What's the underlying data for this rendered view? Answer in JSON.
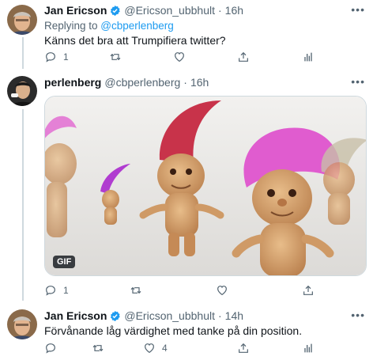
{
  "tweets": [
    {
      "name": "Jan Ericson",
      "handle": "@Ericson_ubbhult",
      "dot": "·",
      "time": "16h",
      "reply_prefix": "Replying to ",
      "reply_handle": "@cbperlenberg",
      "text": "Känns det bra att Trumpifiera twitter?",
      "reply_count": "1",
      "retweet_count": "",
      "like_count": ""
    },
    {
      "name": "perlenberg",
      "handle": "@cbperlenberg",
      "dot": "·",
      "time": "16h",
      "media_badge": "GIF",
      "reply_count": "1",
      "retweet_count": "",
      "like_count": ""
    },
    {
      "name": "Jan Ericson",
      "handle": "@Ericson_ubbhult",
      "dot": "·",
      "time": "14h",
      "text": "Förvånande låg värdighet med tanke  på din position.",
      "reply_count": "",
      "retweet_count": "",
      "like_count": "4"
    }
  ],
  "more_label": "•••",
  "colors": {
    "accent": "#1d9bf0",
    "muted": "#536471",
    "troll_hair_red": "#c8334a",
    "troll_hair_pink": "#e05ccf"
  },
  "icons": [
    "reply-icon",
    "retweet-icon",
    "like-icon",
    "share-icon",
    "analytics-icon",
    "verified-icon",
    "more-icon"
  ]
}
